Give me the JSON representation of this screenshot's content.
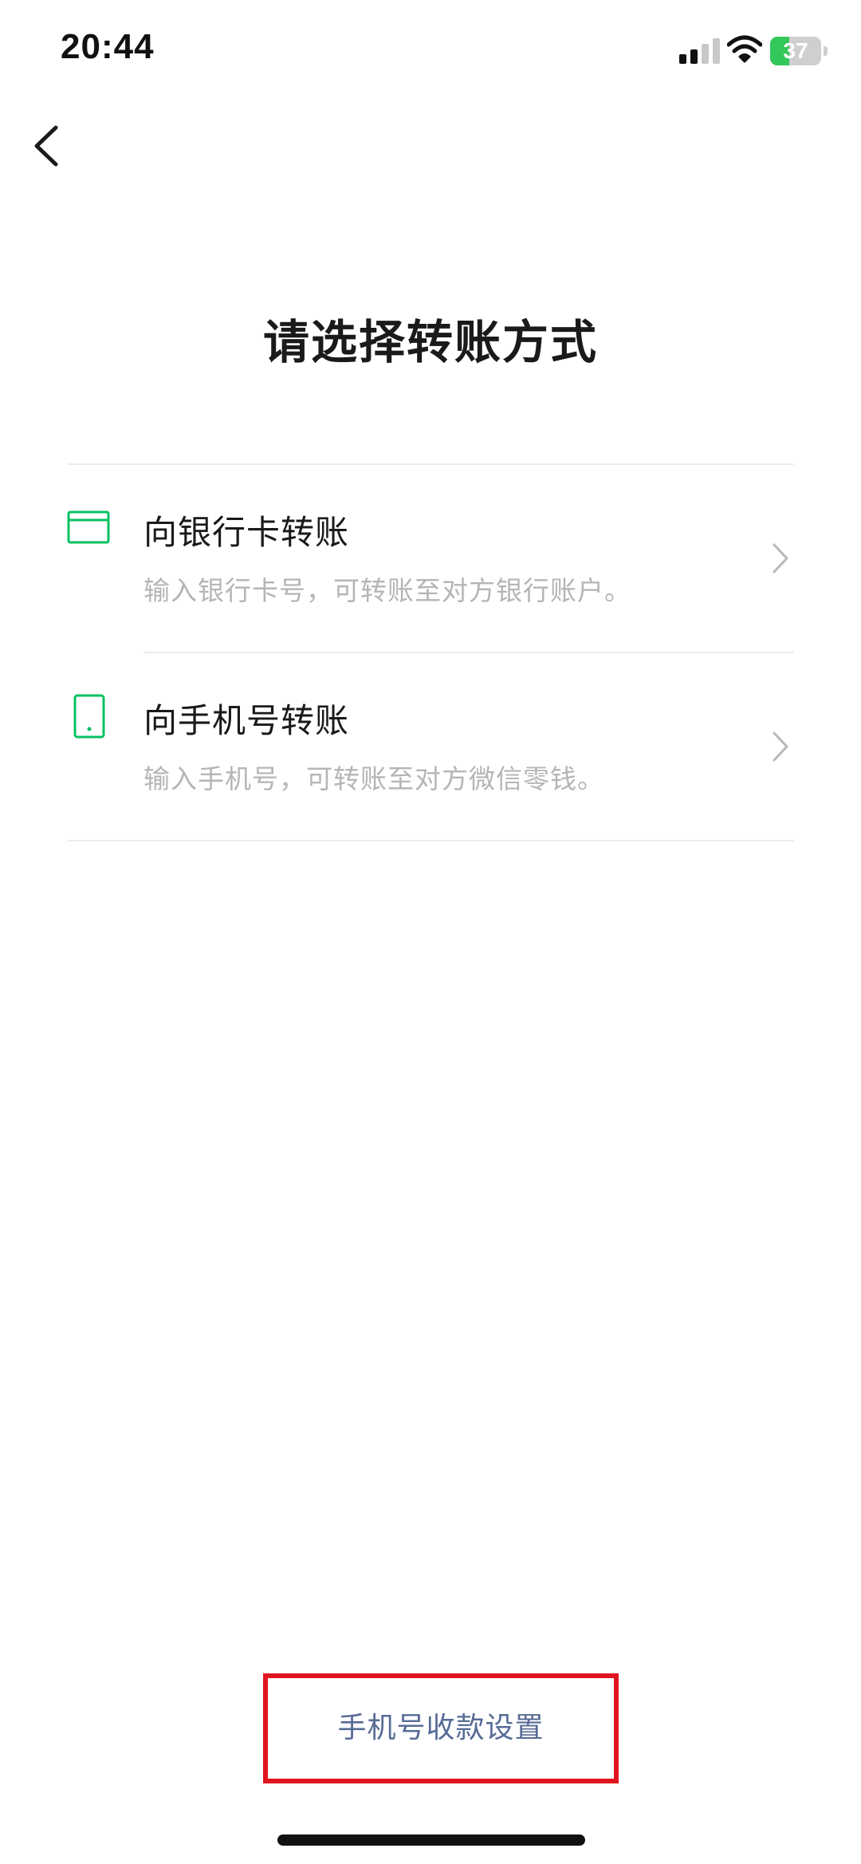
{
  "status_bar": {
    "time": "20:44",
    "battery_level": "37",
    "battery_fraction": 0.37,
    "icons": [
      "signal-icon",
      "wifi-icon",
      "battery-icon"
    ]
  },
  "nav": {
    "back_icon": "chevron-left-icon"
  },
  "page": {
    "title": "请选择转账方式"
  },
  "options": [
    {
      "title": "向银行卡转账",
      "description": "输入银行卡号，可转账至对方银行账户。",
      "icon": "bank-card-icon"
    },
    {
      "title": "向手机号转账",
      "description": "输入手机号，可转账至对方微信零钱。",
      "icon": "mobile-phone-icon"
    }
  ],
  "footer": {
    "link_label": "手机号收款设置"
  },
  "colors": {
    "accent_green": "#07c160",
    "link_blue": "#576b95",
    "highlight_red": "#e0151f",
    "battery_green": "#34c759"
  }
}
